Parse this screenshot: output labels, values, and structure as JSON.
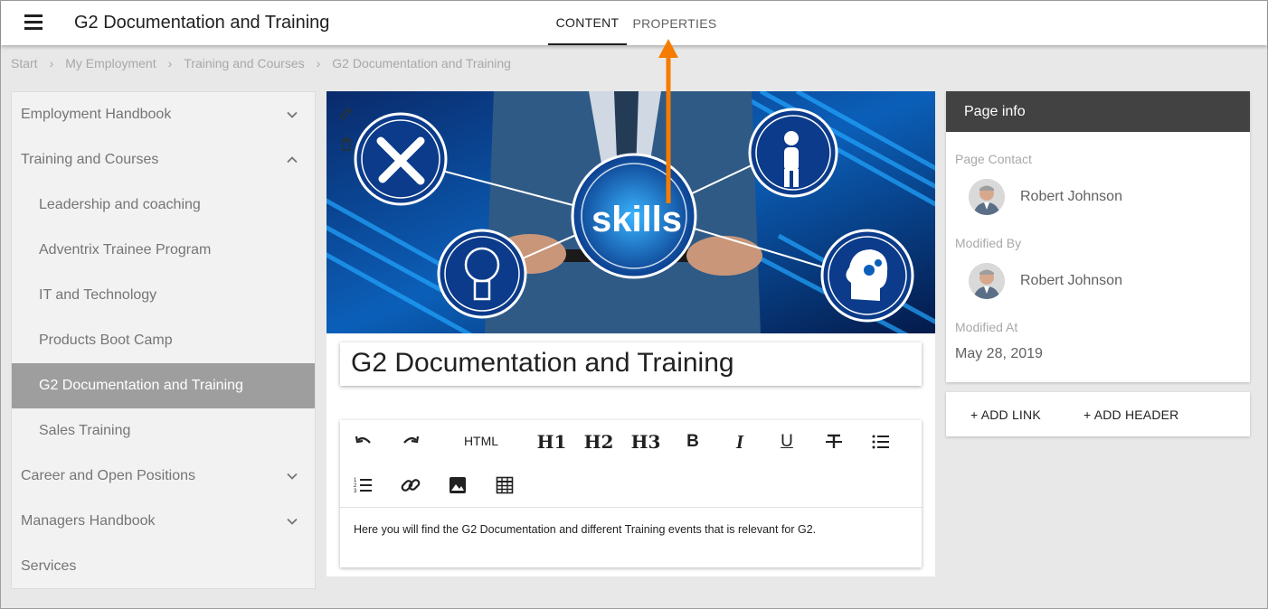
{
  "header": {
    "title": "G2 Documentation and Training",
    "tabs": [
      {
        "label": "CONTENT",
        "active": true
      },
      {
        "label": "PROPERTIES",
        "active": false
      }
    ]
  },
  "breadcrumb": [
    "Start",
    "My Employment",
    "Training and Courses",
    "G2 Documentation and Training"
  ],
  "sidebar": {
    "items": [
      {
        "label": "Employment Handbook",
        "level": 1,
        "chevron": "down"
      },
      {
        "label": "Training and Courses",
        "level": 1,
        "chevron": "up"
      },
      {
        "label": "Leadership and coaching",
        "level": 2
      },
      {
        "label": "Adventrix Trainee Program",
        "level": 2
      },
      {
        "label": "IT and Technology",
        "level": 2
      },
      {
        "label": "Products Boot Camp",
        "level": 2
      },
      {
        "label": "G2 Documentation and Training",
        "level": 2,
        "active": true
      },
      {
        "label": "Sales Training",
        "level": 2
      },
      {
        "label": "Career and Open Positions",
        "level": 1,
        "chevron": "down"
      },
      {
        "label": "Managers Handbook",
        "level": 1,
        "chevron": "down"
      },
      {
        "label": "Services",
        "level": 1
      }
    ]
  },
  "main": {
    "banner_text": "skills",
    "page_title": "G2 Documentation and Training",
    "toolbar": {
      "html_label": "HTML",
      "h1": "H1",
      "h2": "H2",
      "h3": "H3",
      "bold": "B",
      "italic": "I",
      "underline": "U"
    },
    "body_text": "Here you will find the G2 Documentation and different Training events that is relevant for G2."
  },
  "page_info": {
    "header": "Page info",
    "contact_label": "Page Contact",
    "contact_name": "Robert Johnson",
    "modified_by_label": "Modified By",
    "modified_by_name": "Robert Johnson",
    "modified_at_label": "Modified At",
    "modified_at": "May 28, 2019"
  },
  "links_panel": {
    "add_link": "+ ADD LINK",
    "add_header": "+ ADD HEADER"
  },
  "colors": {
    "accent_arrow": "#f57c00",
    "active_nav": "#9e9e9e",
    "panel_header": "#424242"
  }
}
